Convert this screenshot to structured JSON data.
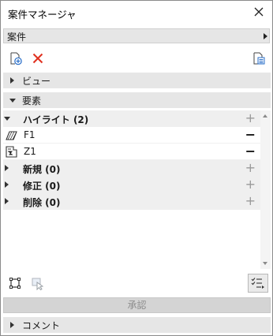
{
  "window": {
    "title": "案件マネージャ"
  },
  "project_select": {
    "label": "案件"
  },
  "sections": {
    "view": {
      "label": "ビュー"
    },
    "elements": {
      "label": "要素"
    },
    "comment": {
      "label": "コメント"
    }
  },
  "tree": {
    "groups": [
      {
        "label": "ハイライト (2)"
      },
      {
        "label": "新規 (0)"
      },
      {
        "label": "修正 (0)"
      },
      {
        "label": "削除 (0)"
      }
    ],
    "children": [
      {
        "label": "F1",
        "icon": "slab-icon"
      },
      {
        "label": "Z1",
        "icon": "zone-icon"
      }
    ]
  },
  "approve_button": {
    "label": "承認"
  },
  "colors": {
    "delete_red": "#e0301e",
    "add_blue": "#2a6fc9"
  }
}
